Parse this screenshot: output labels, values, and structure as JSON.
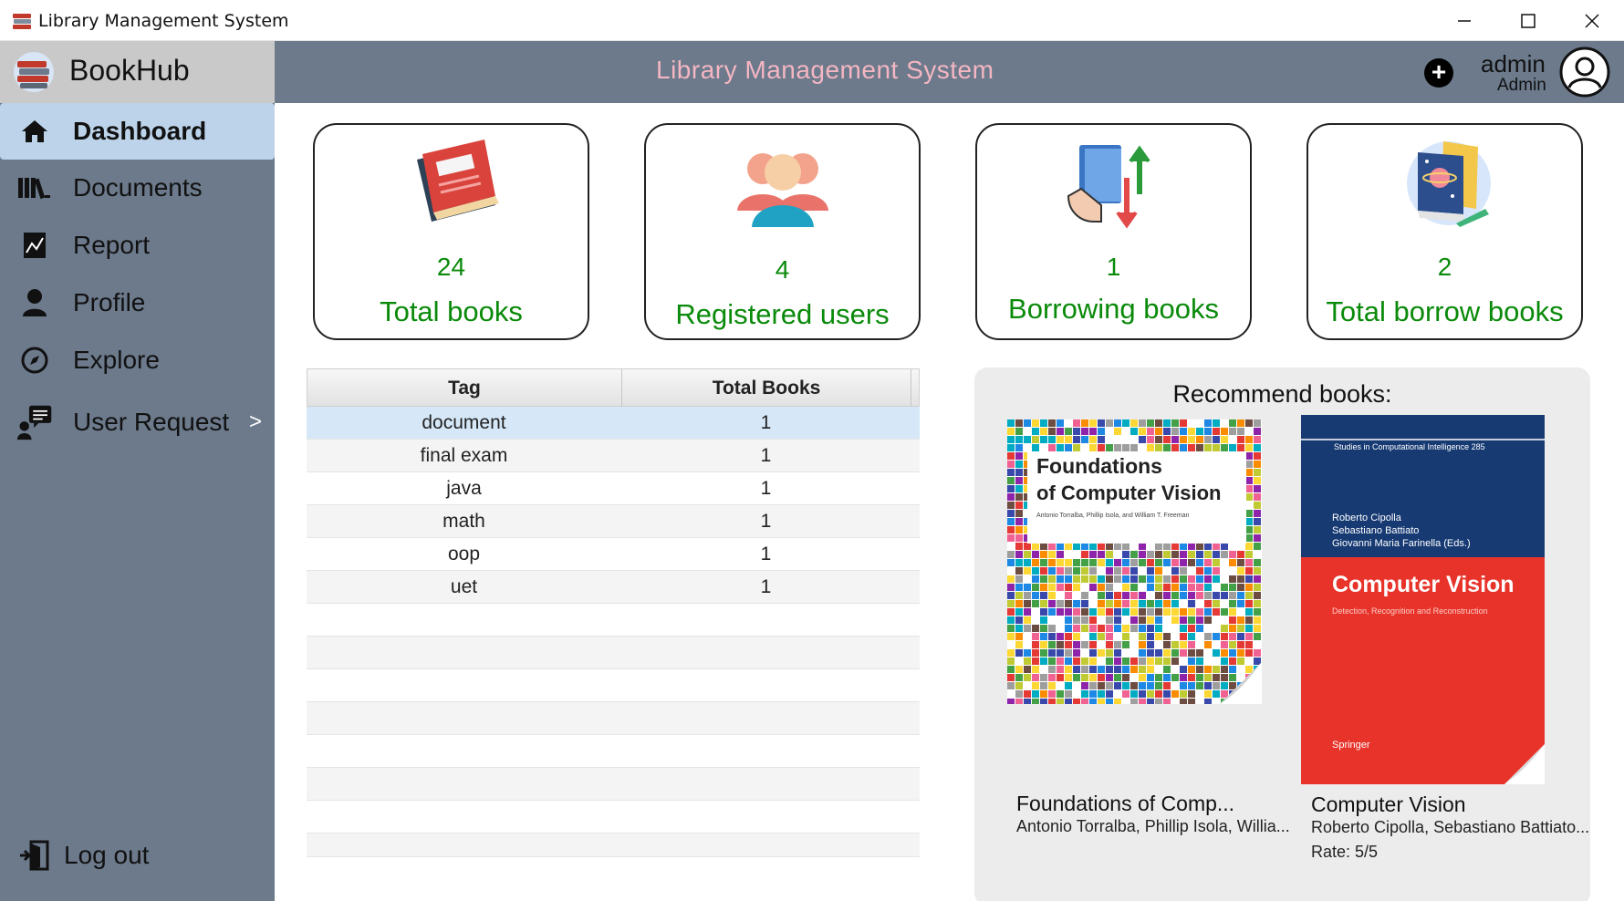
{
  "window": {
    "title": "Library Management System"
  },
  "sidebar": {
    "brand": "BookHub",
    "items": [
      {
        "label": "Dashboard",
        "icon": "home-icon",
        "active": true
      },
      {
        "label": "Documents",
        "icon": "books-icon"
      },
      {
        "label": "Report",
        "icon": "report-icon"
      },
      {
        "label": "Profile",
        "icon": "user-icon"
      },
      {
        "label": "Explore",
        "icon": "compass-icon"
      },
      {
        "label": "User Request",
        "icon": "user-request-icon"
      }
    ],
    "chevron": ">",
    "logout": "Log out"
  },
  "header": {
    "title": "Library Management System",
    "add": "+",
    "username": "admin",
    "role": "Admin"
  },
  "stats": [
    {
      "value": "24",
      "label": "Total books"
    },
    {
      "value": "4",
      "label": "Registered users"
    },
    {
      "value": "1",
      "label": "Borrowing books"
    },
    {
      "value": "2",
      "label": "Total borrow books"
    }
  ],
  "tag_table": {
    "headers": [
      "Tag",
      "Total Books"
    ],
    "rows": [
      [
        "document",
        "1"
      ],
      [
        "final exam",
        "1"
      ],
      [
        "java",
        "1"
      ],
      [
        "math",
        "1"
      ],
      [
        "oop",
        "1"
      ],
      [
        "uet",
        "1"
      ]
    ]
  },
  "recommend": {
    "title": "Recommend  books:",
    "books": [
      {
        "title": "Foundations of Comp...",
        "authors": "Antonio Torralba, Phillip Isola, Willia...",
        "cover_title_1": "Foundations",
        "cover_title_2": "of Computer Vision",
        "cover_authors": "Antonio Torralba, Phillip Isola, and William T. Freeman"
      },
      {
        "title": "Computer Vision",
        "authors": "Roberto Cipolla, Sebastiano Battiato...",
        "rate": "Rate: 5/5",
        "cover_series": "Studies in Computational Intelligence 285",
        "cover_editors_1": "Roberto Cipolla",
        "cover_editors_2": "Sebastiano Battiato",
        "cover_editors_3": "Giovanni Maria Farinella (Eds.)",
        "cover_title": "Computer Vision",
        "cover_subtitle": "Detection, Recognition and Reconstruction",
        "cover_publisher": "Springer"
      }
    ]
  },
  "colors": {
    "sidebar": "#6c7a8c",
    "active_nav": "#bcd3ea",
    "header_title": "#f4b6c2",
    "stat_text": "#0a8a0a"
  }
}
